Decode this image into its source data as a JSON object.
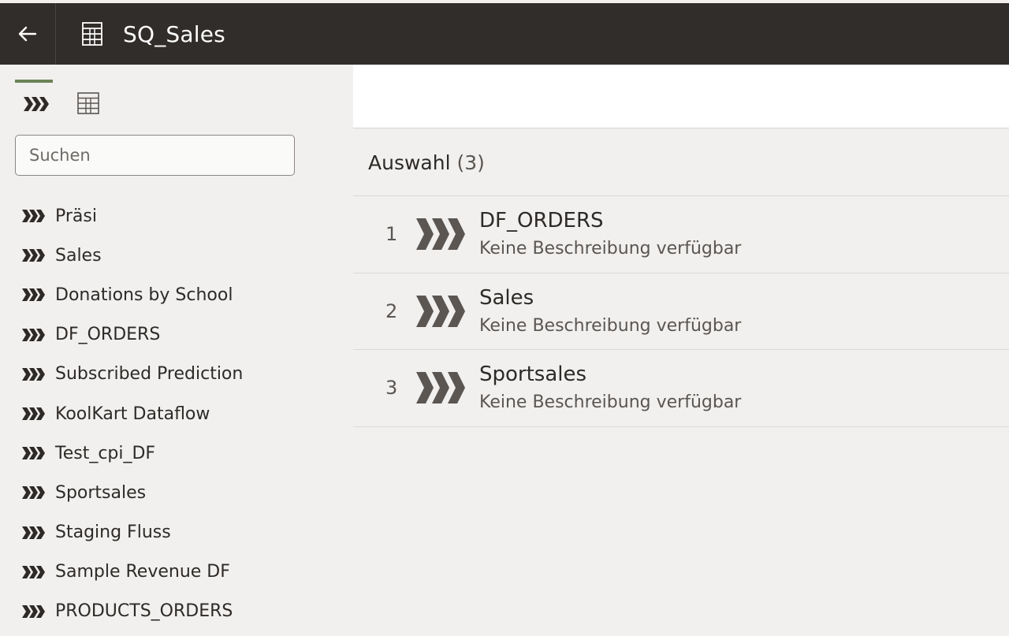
{
  "header": {
    "title": "SQ_Sales",
    "back_icon": "arrow-left-icon",
    "title_icon": "sequence-icon"
  },
  "sidebar": {
    "tabs": [
      {
        "icon": "dataflow-icon",
        "active": true
      },
      {
        "icon": "sequence-icon",
        "active": false
      }
    ],
    "search_placeholder": "Suchen",
    "items": [
      {
        "label": "Präsi"
      },
      {
        "label": "Sales"
      },
      {
        "label": "Donations by School"
      },
      {
        "label": "DF_ORDERS"
      },
      {
        "label": "Subscribed Prediction"
      },
      {
        "label": "KoolKart Dataflow"
      },
      {
        "label": "Test_cpi_DF"
      },
      {
        "label": "Sportsales"
      },
      {
        "label": "Staging Fluss"
      },
      {
        "label": "Sample Revenue DF"
      },
      {
        "label": "PRODUCTS_ORDERS"
      }
    ]
  },
  "main": {
    "selection_label": "Auswahl",
    "selection_count": "(3)",
    "selections": [
      {
        "number": "1",
        "name": "DF_ORDERS",
        "description": "Keine Beschreibung verfügbar"
      },
      {
        "number": "2",
        "name": "Sales",
        "description": "Keine Beschreibung verfügbar"
      },
      {
        "number": "3",
        "name": "Sportsales",
        "description": "Keine Beschreibung verfügbar"
      }
    ]
  },
  "colors": {
    "header_bg": "#312d2a",
    "sidebar_bg": "#f1f0ef",
    "active_tab": "#6b8356",
    "dataflow_icon": "#2d2a27",
    "selection_icon": "#5b5652"
  }
}
